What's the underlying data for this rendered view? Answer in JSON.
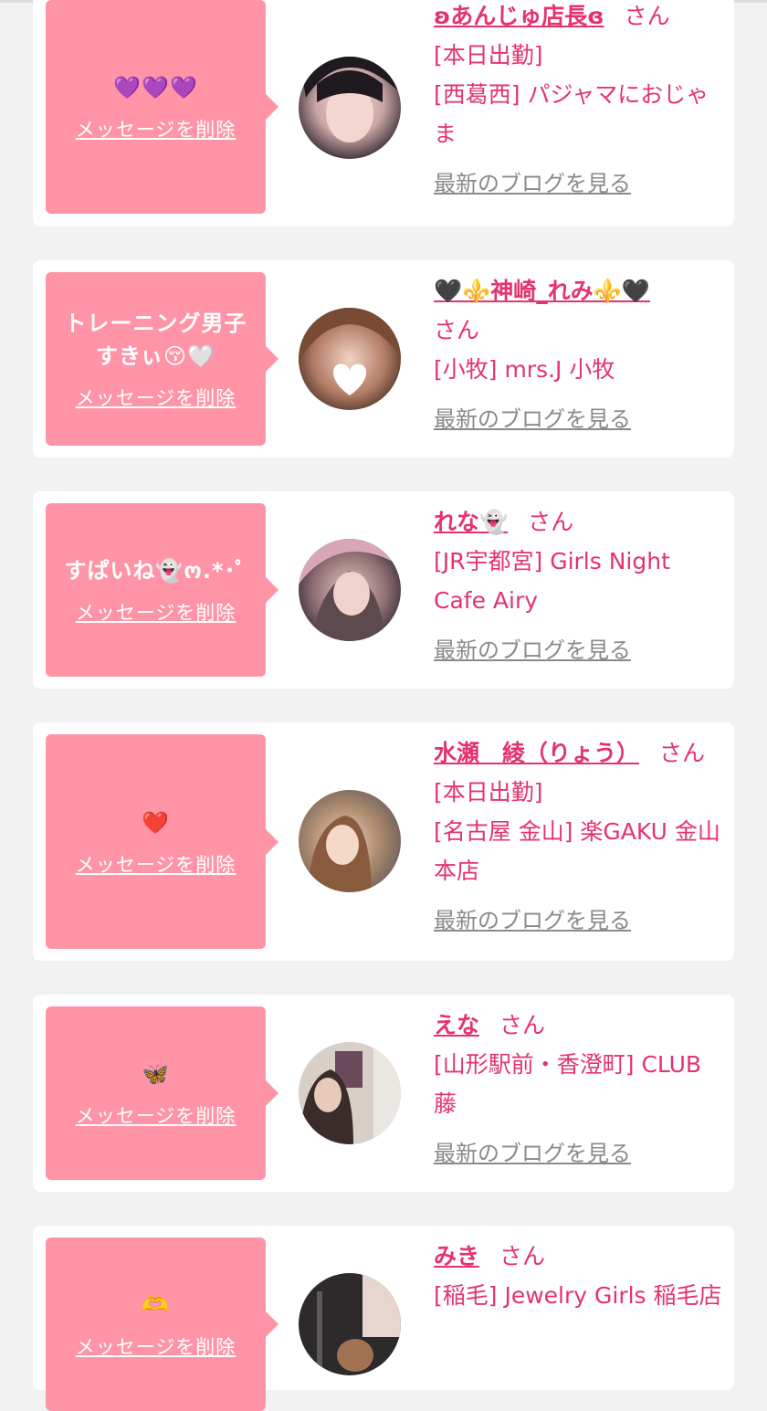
{
  "common": {
    "delete_label": "メッセージを削除",
    "blog_label": "最新のブログを見る",
    "san_label": "さん"
  },
  "colors": {
    "bubble": "#ff94a7",
    "accent": "#e5336c",
    "muted_link": "#8a8a8a",
    "background": "#f2f2f2"
  },
  "favorites": [
    {
      "message": "💜💜💜",
      "name": "ʚあんじゅ店長ɞ",
      "lines": [
        "[本日出勤]",
        "[西葛西] パジャマにおじゃま"
      ]
    },
    {
      "message": "トレーニング男子すきぃ😚🤍",
      "name": "🖤⚜️神崎_れみ⚜️🖤",
      "lines": [
        "[小牧] mrs.J 小牧"
      ]
    },
    {
      "message": "すぱいね👻ო.*･ﾟ",
      "name": "れな👻",
      "lines": [
        "[JR宇都宮] Girls Night Cafe Airy"
      ]
    },
    {
      "message": "❤️",
      "name": "水瀬　綾（りょう）",
      "lines": [
        "[本日出勤]",
        "[名古屋 金山] 楽GAKU 金山本店"
      ]
    },
    {
      "message": "🦋",
      "name": "えな",
      "lines": [
        "[山形駅前・香澄町] CLUB 藤"
      ]
    },
    {
      "message": "🫶",
      "name": "みき",
      "lines": [
        "[稲毛] Jewelry Girls 稲毛店"
      ]
    }
  ]
}
